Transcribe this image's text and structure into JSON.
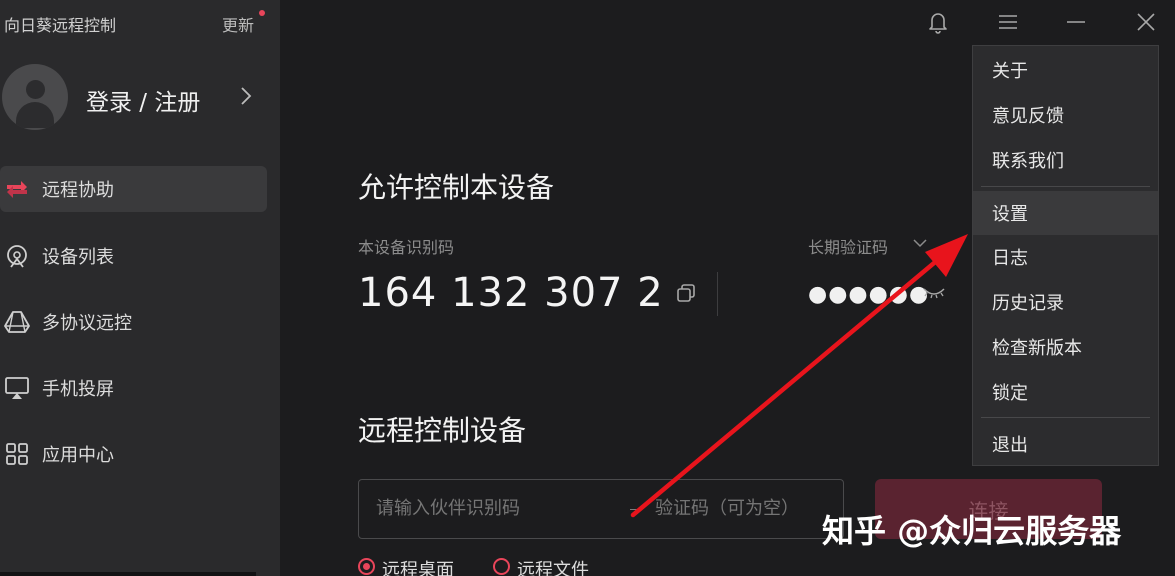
{
  "app": {
    "title": "向日葵远程控制",
    "update_label": "更新"
  },
  "user": {
    "login_label": "登录 / 注册"
  },
  "sidebar": {
    "items": [
      {
        "label": "远程协助",
        "icon": "remote-assist-icon",
        "active": true
      },
      {
        "label": "设备列表",
        "icon": "device-list-icon",
        "active": false
      },
      {
        "label": "多协议远控",
        "icon": "multi-protocol-icon",
        "active": false
      },
      {
        "label": "手机投屏",
        "icon": "screen-cast-icon",
        "active": false
      },
      {
        "label": "应用中心",
        "icon": "app-center-icon",
        "active": false
      }
    ]
  },
  "main": {
    "allow_title": "允许控制本设备",
    "device_id_label": "本设备识别码",
    "device_id": "164 132 307 2",
    "code_type_label": "长期验证码",
    "code_masked": "●●●●●●",
    "remote_title": "远程控制设备",
    "partner_placeholder": "请输入伙伴识别码",
    "code_placeholder": "验证码（可为空）",
    "connect_label": "连接",
    "modes": [
      {
        "label": "远程桌面",
        "checked": true
      },
      {
        "label": "远程文件",
        "checked": false
      }
    ]
  },
  "menu": {
    "items": [
      "关于",
      "意见反馈",
      "联系我们",
      "设置",
      "日志",
      "历史记录",
      "检查新版本",
      "锁定",
      "退出"
    ],
    "hovered": "设置"
  },
  "watermark": "知乎 @众归云服务器",
  "colors": {
    "accent": "#e8455a",
    "annotation_arrow": "#e8141c",
    "background": "#1c1c1e",
    "sidebar": "#2a2a2c"
  }
}
